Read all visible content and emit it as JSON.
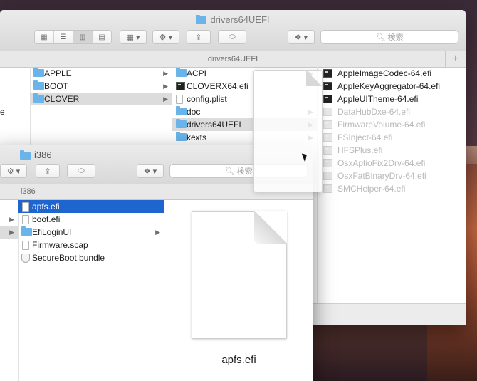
{
  "back_window": {
    "title": "drivers64UEFI",
    "path_label": "drivers64UEFI",
    "search_placeholder": "検索",
    "partial_left_text": "e",
    "col1": [
      "APPLE",
      "BOOT",
      "CLOVER"
    ],
    "col2": [
      "ACPI",
      "CLOVERX64.efi",
      "config.plist",
      "doc",
      "drivers64UEFI",
      "kexts"
    ],
    "col3": [
      "AppleImageCodec-64.efi",
      "AppleKeyAggregator-64.efi",
      "AppleUITheme-64.efi",
      "DataHubDxe-64.efi",
      "FirmwareVolume-64.efi",
      "FSInject-64.efi",
      "HFSPlus.efi",
      "OsxAptioFix2Drv-64.efi",
      "OsxFatBinaryDrv-64.efi",
      "SMCHelper-64.efi"
    ],
    "plus_label": "+"
  },
  "front_window": {
    "title": "i386",
    "path_label": "i386",
    "search_placeholder": "検索",
    "files": [
      "apfs.efi",
      "boot.efi",
      "EfiLoginUI",
      "Firmware.scap",
      "SecureBoot.bundle"
    ],
    "preview_name": "apfs.efi"
  },
  "colors": {
    "selection_blue": "#1f65d0",
    "folder_blue": "#6ab4ea"
  }
}
